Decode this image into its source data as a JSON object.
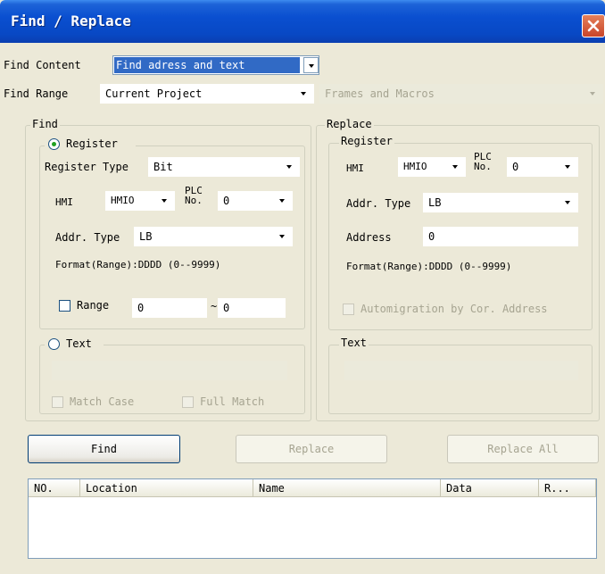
{
  "window": {
    "title": "Find / Replace"
  },
  "find_content": {
    "label": "Find Content",
    "value": "Find adress and text"
  },
  "find_range": {
    "label": "Find Range",
    "value": "Current Project",
    "scope_value": "Frames and Macros"
  },
  "find": {
    "legend": "Find",
    "register": {
      "legend": "Register",
      "type_label": "Register Type",
      "type_value": "Bit",
      "hmi_label": "HMI",
      "hmi_value": "HMIO",
      "plc_label_1": "PLC",
      "plc_label_2": "No.",
      "plc_value": "0",
      "addr_type_label": "Addr. Type",
      "addr_type_value": "LB",
      "format_text": "Format(Range):DDDD (0--9999)",
      "range_label": "Range",
      "range_from": "0",
      "range_sep": "~",
      "range_to": "0"
    },
    "text": {
      "legend": "Text",
      "value": "",
      "match_case_label": "Match Case",
      "full_match_label": "Full Match"
    }
  },
  "replace": {
    "legend": "Replace",
    "register": {
      "legend": "Register",
      "hmi_label": "HMI",
      "hmi_value": "HMIO",
      "plc_label_1": "PLC",
      "plc_label_2": "No.",
      "plc_value": "0",
      "addr_type_label": "Addr. Type",
      "addr_type_value": "LB",
      "address_label": "Address",
      "address_value": "0",
      "format_text": "Format(Range):DDDD (0--9999)",
      "automigration_label": "Automigration by Cor. Address"
    },
    "text": {
      "legend": "Text",
      "value": ""
    }
  },
  "buttons": {
    "find": "Find",
    "replace": "Replace",
    "replace_all": "Replace All"
  },
  "results": {
    "columns": [
      "NO.",
      "Location",
      "Name",
      "Data",
      "R..."
    ]
  },
  "colors": {
    "title_bar": "#0a4fd0",
    "selection": "#316ac5",
    "dialog_bg": "#ece9d8"
  }
}
